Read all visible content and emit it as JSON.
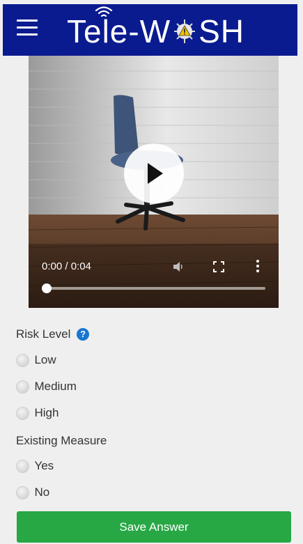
{
  "header": {
    "logo_part1": "Tele-W",
    "logo_part2": "SH",
    "menu_icon": "hamburger-menu-icon",
    "bar_color": "#0a1b8f"
  },
  "video": {
    "time": "0:00 / 0:04",
    "progress": 0.0,
    "icons": [
      "play-icon",
      "volume-icon",
      "fullscreen-icon",
      "more-vertical-icon"
    ]
  },
  "risk": {
    "label": "Risk Level",
    "help": "?",
    "options": [
      "Low",
      "Medium",
      "High"
    ]
  },
  "measure": {
    "label": "Existing Measure",
    "options": [
      "Yes",
      "No"
    ]
  },
  "save_button": {
    "label": "Save Answer",
    "color": "#28a745"
  }
}
